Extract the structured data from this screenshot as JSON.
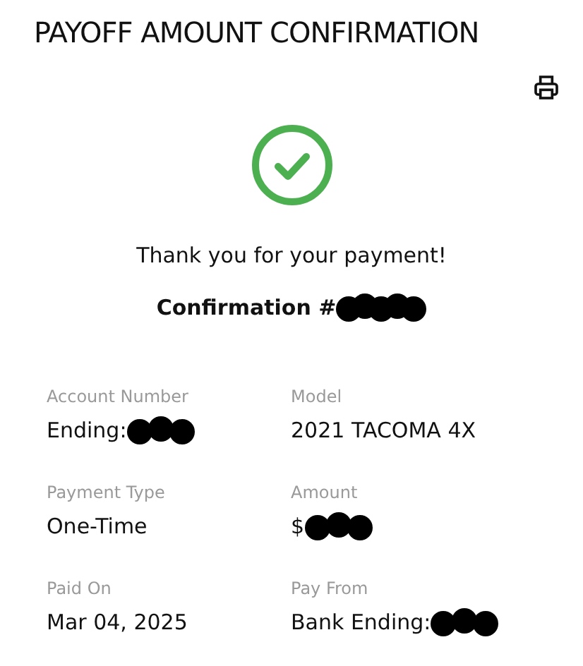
{
  "title": "PAYOFF AMOUNT CONFIRMATION",
  "message": "Thank you for your payment!",
  "confirmation": {
    "text": "Confirmation #",
    "redacted": true
  },
  "details": [
    {
      "label": "Account Number",
      "value": "Ending:",
      "redacted": true
    },
    {
      "label": "Model",
      "value": "2021 TACOMA 4X",
      "redacted": false
    },
    {
      "label": "Payment Type",
      "value": "One-Time",
      "redacted": false
    },
    {
      "label": "Amount",
      "value": "$",
      "redacted": true
    },
    {
      "label": "Paid On",
      "value": "Mar 04, 2025",
      "redacted": false
    },
    {
      "label": "Pay From",
      "value": "Bank Ending:",
      "redacted": true
    }
  ]
}
